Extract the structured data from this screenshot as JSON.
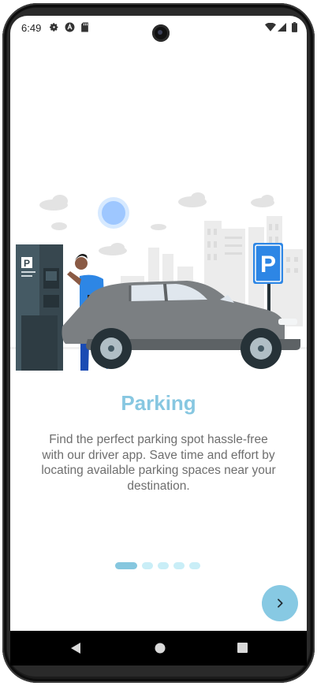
{
  "status_bar": {
    "time": "6:49"
  },
  "onboarding": {
    "title": "Parking",
    "description": "Find the perfect parking spot hassle-free with our driver app. Save time and effort by locating available parking spaces near your destination.",
    "illustration_sign": "P",
    "pages_total": 5,
    "current_page": 1
  },
  "icons": {
    "settings": "gear-icon",
    "app": "a-badge-icon",
    "sd_card": "sd-card-icon",
    "wifi": "wifi-icon",
    "signal": "signal-icon",
    "battery": "battery-icon",
    "next": "chevron-right-icon",
    "back": "triangle-back-icon",
    "home": "circle-home-icon",
    "recents": "square-recents-icon"
  },
  "colors": {
    "accent": "#87c7e1",
    "dot_inactive": "#c9eef7",
    "dot_active": "#86c7df",
    "text_gray": "#6e6e6e"
  }
}
